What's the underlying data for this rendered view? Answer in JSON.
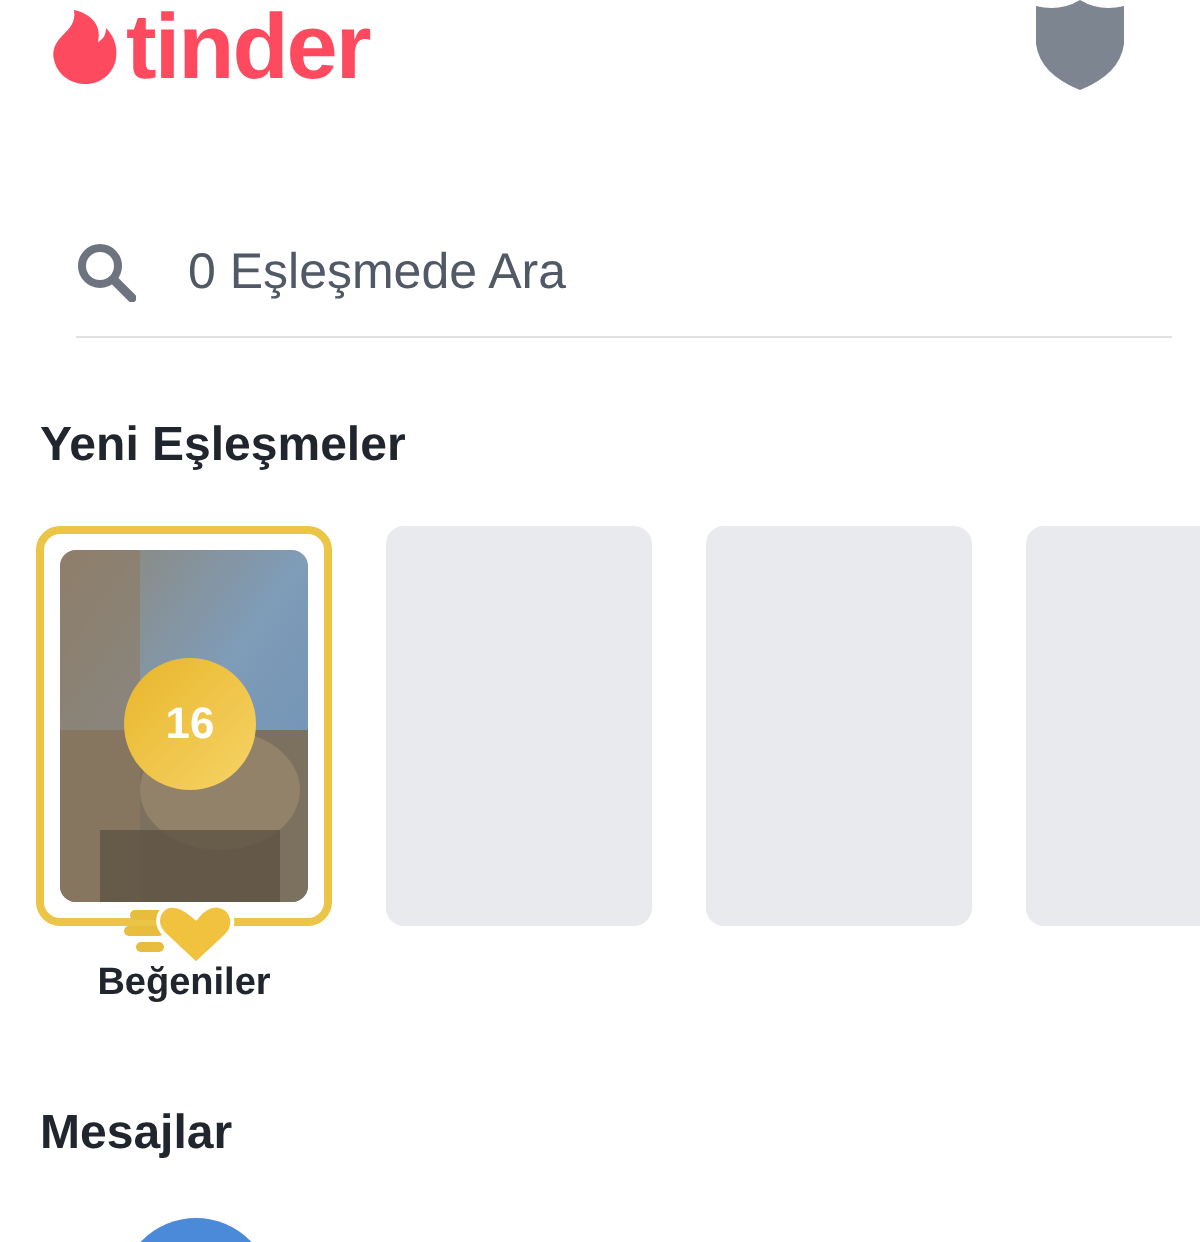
{
  "header": {
    "logo_text": "tinder"
  },
  "search": {
    "placeholder": "0 Eşleşmede Ara"
  },
  "new_matches": {
    "title": "Yeni Eşleşmeler",
    "items": [
      {
        "kind": "likes",
        "count": "16",
        "label": "Beğeniler"
      },
      {
        "kind": "empty"
      },
      {
        "kind": "empty"
      },
      {
        "kind": "empty"
      }
    ]
  },
  "messages": {
    "title": "Mesajlar",
    "items": [
      {
        "kind": "avatar"
      }
    ]
  }
}
